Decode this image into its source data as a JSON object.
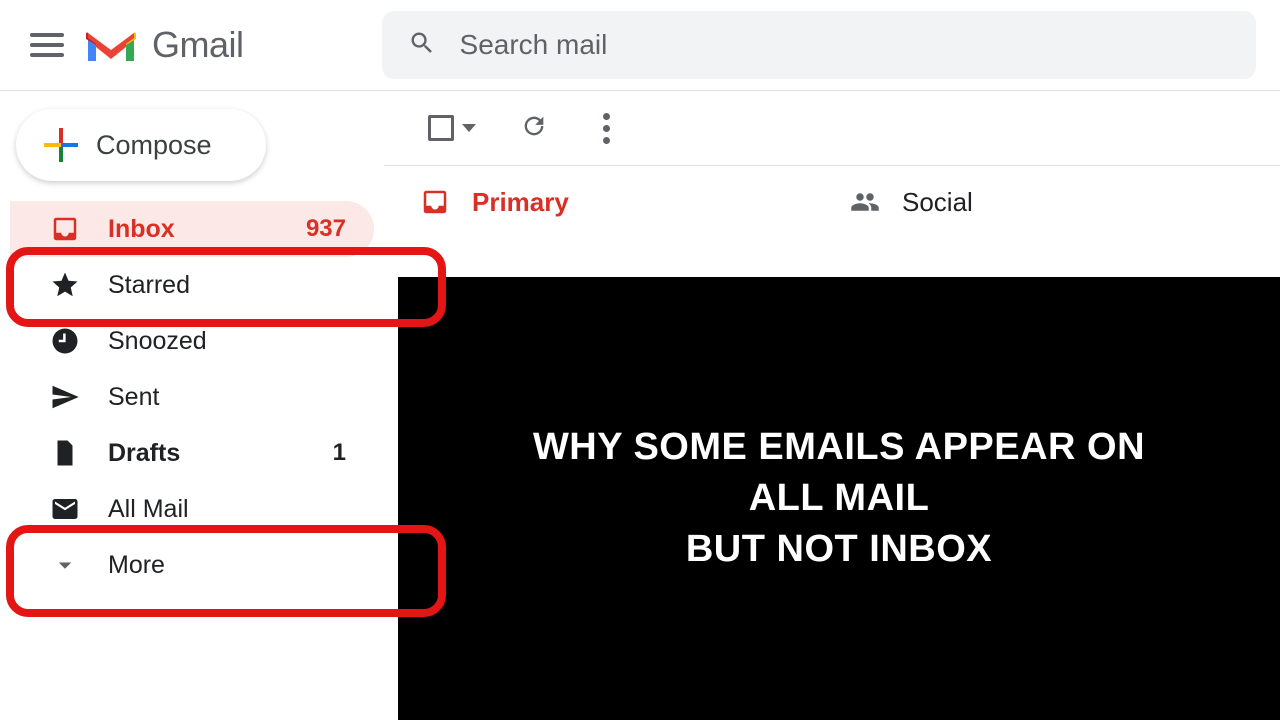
{
  "header": {
    "brand": "Gmail",
    "search_placeholder": "Search mail"
  },
  "sidebar": {
    "compose": "Compose",
    "items": [
      {
        "label": "Inbox",
        "count": "937"
      },
      {
        "label": "Starred",
        "count": ""
      },
      {
        "label": "Snoozed",
        "count": ""
      },
      {
        "label": "Sent",
        "count": ""
      },
      {
        "label": "Drafts",
        "count": "1"
      },
      {
        "label": "All Mail",
        "count": ""
      },
      {
        "label": "More",
        "count": ""
      }
    ]
  },
  "tabs": {
    "primary": "Primary",
    "social": "Social"
  },
  "overlay": {
    "line1": "WHY SOME EMAILS APPEAR ON",
    "line2": "ALL MAIL",
    "line3": "BUT NOT INBOX"
  }
}
